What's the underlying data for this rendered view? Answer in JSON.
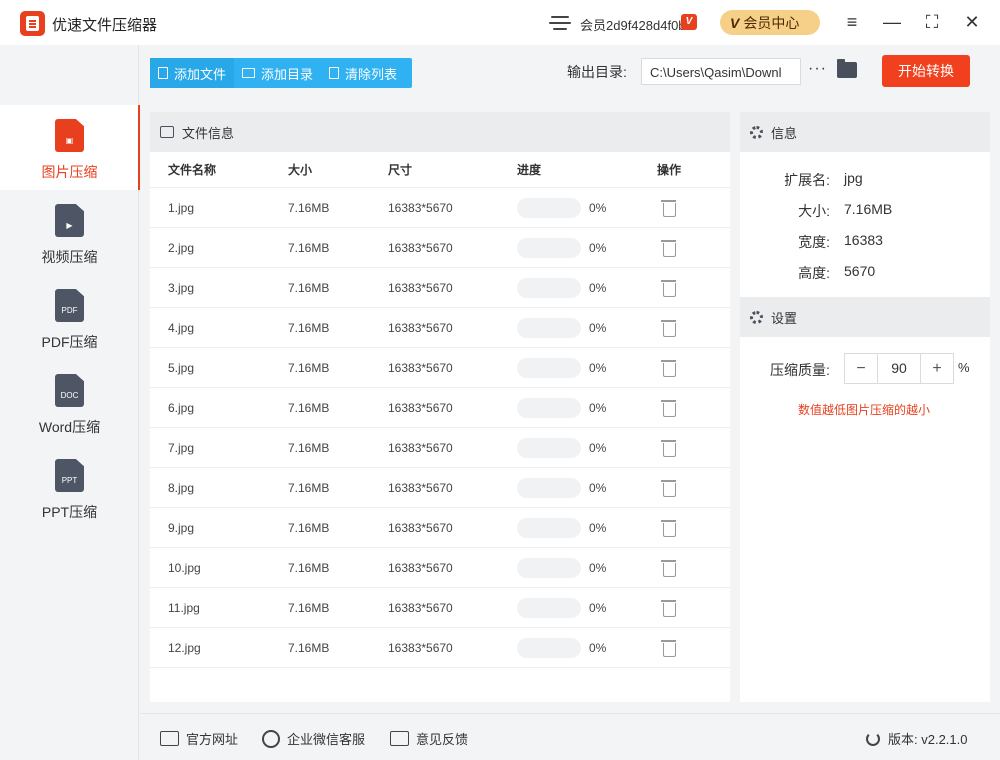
{
  "window": {
    "title": "优速文件压缩器",
    "member_id": "会员2d9f428d4f0b",
    "vip_badge": "V",
    "vip_center_v": "V",
    "vip_center_label": "会员中心",
    "menu_icon": "≡",
    "min_icon": "—",
    "max_icon": "⛶",
    "close_icon": "✕"
  },
  "sidebar": {
    "items": [
      {
        "label": "图片压缩",
        "glyph": "▣",
        "active": true
      },
      {
        "label": "视频压缩",
        "glyph": "▶",
        "active": false
      },
      {
        "label": "PDF压缩",
        "glyph": "PDF",
        "active": false
      },
      {
        "label": "Word压缩",
        "glyph": "DOC",
        "active": false
      },
      {
        "label": "PPT压缩",
        "glyph": "PPT",
        "active": false
      }
    ]
  },
  "toolbar": {
    "add_file": "添加文件",
    "add_dir": "添加目录",
    "clear_list": "清除列表",
    "output_label": "输出目录:",
    "output_path": "C:\\Users\\Qasim\\Downl",
    "more": "···",
    "start": "开始转换"
  },
  "file_panel": {
    "title": "文件信息",
    "columns": {
      "name": "文件名称",
      "size": "大小",
      "dim": "尺寸",
      "progress": "进度",
      "op": "操作"
    },
    "rows": [
      {
        "name": "1.jpg",
        "size": "7.16MB",
        "dim": "16383*5670",
        "progress": "0%"
      },
      {
        "name": "2.jpg",
        "size": "7.16MB",
        "dim": "16383*5670",
        "progress": "0%"
      },
      {
        "name": "3.jpg",
        "size": "7.16MB",
        "dim": "16383*5670",
        "progress": "0%"
      },
      {
        "name": "4.jpg",
        "size": "7.16MB",
        "dim": "16383*5670",
        "progress": "0%"
      },
      {
        "name": "5.jpg",
        "size": "7.16MB",
        "dim": "16383*5670",
        "progress": "0%"
      },
      {
        "name": "6.jpg",
        "size": "7.16MB",
        "dim": "16383*5670",
        "progress": "0%"
      },
      {
        "name": "7.jpg",
        "size": "7.16MB",
        "dim": "16383*5670",
        "progress": "0%"
      },
      {
        "name": "8.jpg",
        "size": "7.16MB",
        "dim": "16383*5670",
        "progress": "0%"
      },
      {
        "name": "9.jpg",
        "size": "7.16MB",
        "dim": "16383*5670",
        "progress": "0%"
      },
      {
        "name": "10.jpg",
        "size": "7.16MB",
        "dim": "16383*5670",
        "progress": "0%"
      },
      {
        "name": "11.jpg",
        "size": "7.16MB",
        "dim": "16383*5670",
        "progress": "0%"
      },
      {
        "name": "12.jpg",
        "size": "7.16MB",
        "dim": "16383*5670",
        "progress": "0%"
      }
    ]
  },
  "info_panel": {
    "title": "信息",
    "ext_label": "扩展名:",
    "ext": "jpg",
    "size_label": "大小:",
    "size": "7.16MB",
    "width_label": "宽度:",
    "width": "16383",
    "height_label": "高度:",
    "height": "5670"
  },
  "settings": {
    "title": "设置",
    "quality_label": "压缩质量:",
    "quality": "90",
    "minus": "−",
    "plus": "+",
    "unit": "%",
    "hint": "数值越低图片压缩的越小"
  },
  "footer": {
    "website": "官方网址",
    "wechat": "企业微信客服",
    "feedback": "意见反馈",
    "version": "版本: v2.2.1.0"
  },
  "colors": {
    "accent": "#e8401e",
    "toolbar": "#2fb1f2",
    "vip": "#f6d088"
  }
}
